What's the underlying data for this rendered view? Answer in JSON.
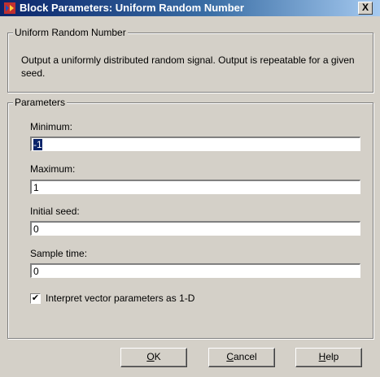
{
  "window": {
    "title": "Block Parameters: Uniform Random Number",
    "close_label": "X",
    "icon": "simulink-block-icon"
  },
  "block_group": {
    "legend": "Uniform Random Number",
    "description": "Output a uniformly distributed random signal.  Output is repeatable for a given seed."
  },
  "parameters": {
    "legend": "Parameters",
    "minimum": {
      "label": "Minimum:",
      "value": "-1"
    },
    "maximum": {
      "label": "Maximum:",
      "value": "1"
    },
    "initial_seed": {
      "label": "Initial seed:",
      "value": "0"
    },
    "sample_time": {
      "label": "Sample time:",
      "value": "0"
    },
    "interpret_vector": {
      "label": "Interpret vector parameters as 1-D",
      "checked": true,
      "mark": "✔"
    }
  },
  "buttons": {
    "ok": {
      "label": "OK"
    },
    "cancel": {
      "label": "Cancel"
    },
    "help": {
      "label": "Help"
    }
  }
}
